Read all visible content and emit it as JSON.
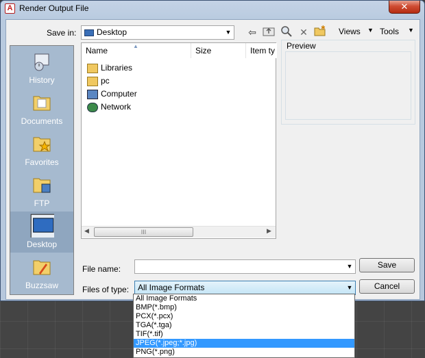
{
  "window": {
    "title": "Render Output File",
    "close_label": "✕"
  },
  "toolbar": {
    "save_in_label": "Save in:",
    "save_in_value": "Desktop",
    "views_label": "Views",
    "tools_label": "Tools"
  },
  "places": [
    {
      "label": "History",
      "icon": "history-icon"
    },
    {
      "label": "Documents",
      "icon": "documents-icon"
    },
    {
      "label": "Favorites",
      "icon": "favorites-icon"
    },
    {
      "label": "FTP",
      "icon": "ftp-icon"
    },
    {
      "label": "Desktop",
      "icon": "desktop-icon"
    },
    {
      "label": "Buzzsaw",
      "icon": "buzzsaw-icon"
    }
  ],
  "filelist": {
    "columns": [
      "Name",
      "Size",
      "Item ty"
    ],
    "items": [
      {
        "name": "Libraries",
        "icon": "libraries-icon"
      },
      {
        "name": "pc",
        "icon": "user-folder-icon"
      },
      {
        "name": "Computer",
        "icon": "computer-icon"
      },
      {
        "name": "Network",
        "icon": "network-icon"
      }
    ],
    "scroll_grip": "III"
  },
  "preview": {
    "label": "Preview"
  },
  "form": {
    "file_name_label": "File name:",
    "file_name_value": "",
    "files_of_type_label": "Files of type:",
    "files_of_type_value": "All Image Formats",
    "save_label": "Save",
    "cancel_label": "Cancel"
  },
  "file_type_options": [
    "All Image Formats",
    "BMP(*.bmp)",
    "PCX(*.pcx)",
    "TGA(*.tga)",
    "TIF(*.tif)",
    "JPEG(*.jpeg;*.jpg)",
    "PNG(*.png)"
  ],
  "file_type_selected": "JPEG(*.jpeg;*.jpg)",
  "colors": {
    "accent": "#3399ff",
    "places_bg": "#a6bacf"
  }
}
